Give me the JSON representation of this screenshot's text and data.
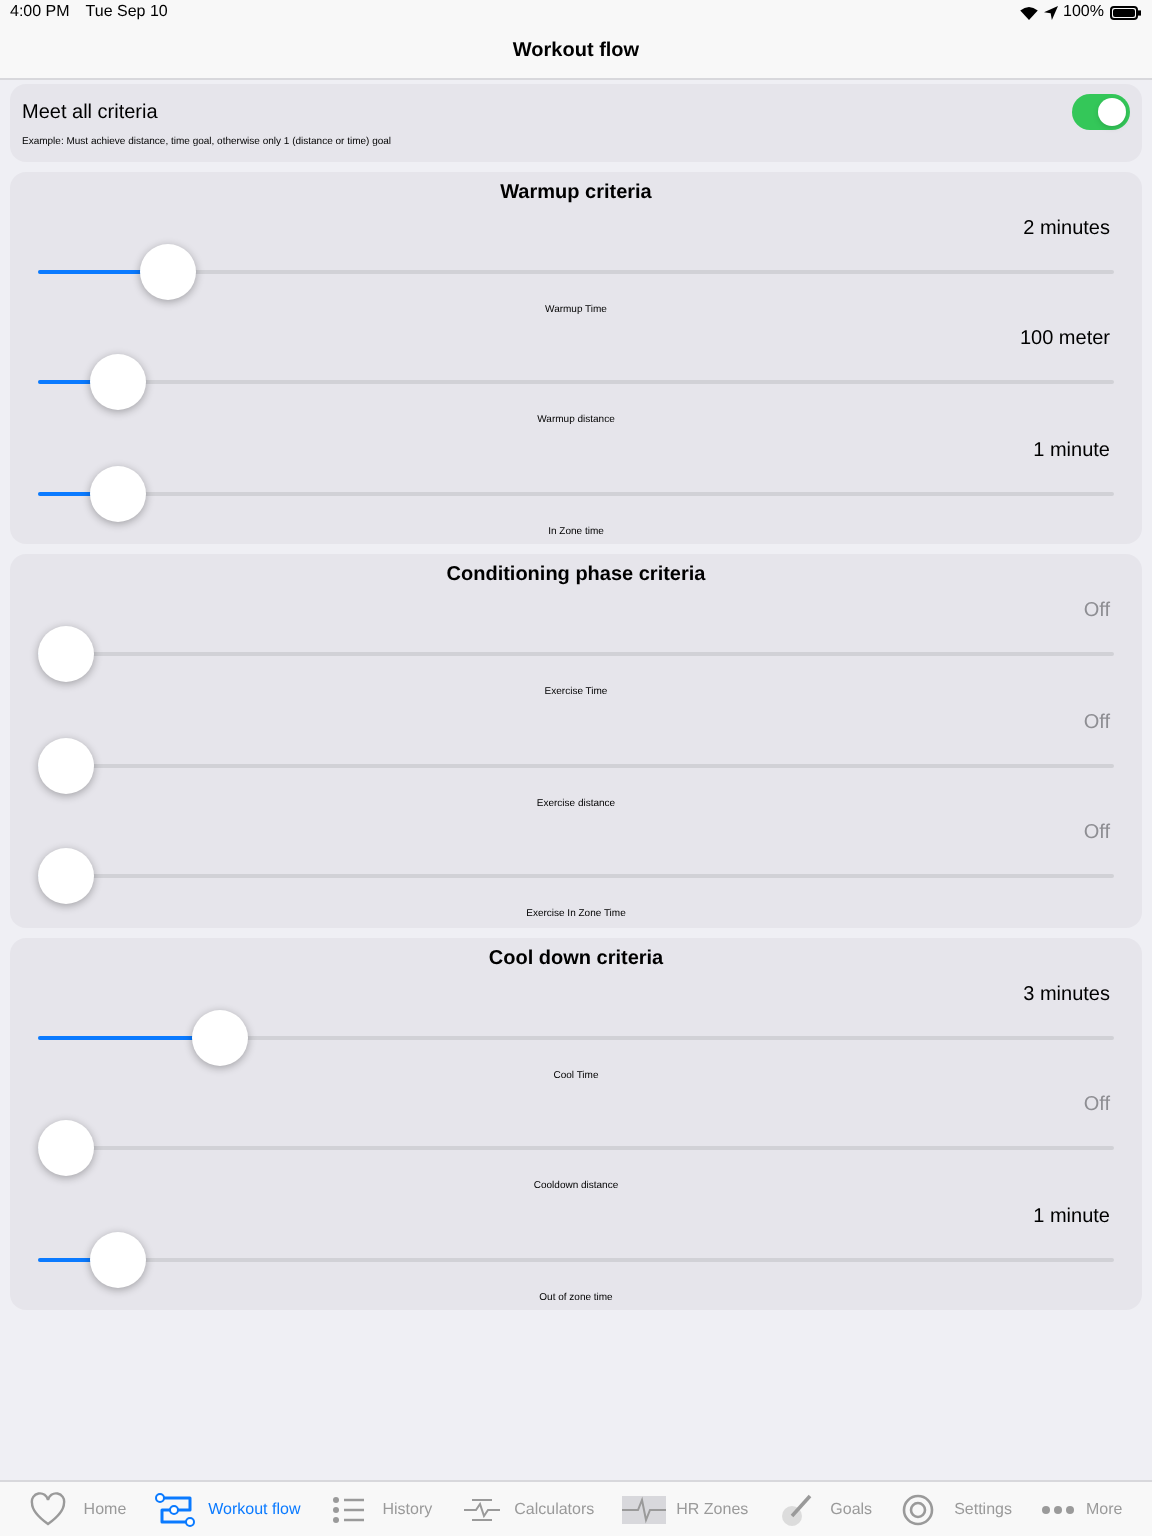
{
  "status_bar": {
    "time": "4:00 PM",
    "date": "Tue Sep 10",
    "battery": "100%"
  },
  "nav_bar": {
    "title": "Workout flow"
  },
  "meet_all": {
    "label": "Meet all criteria",
    "on": true,
    "note": "Example: Must achieve distance, time goal, otherwise only 1 (distance or time) goal"
  },
  "sections": [
    {
      "title": "Warmup criteria",
      "sliders": [
        {
          "reading": "2 minutes",
          "level": 0.1,
          "label": "Warmup Time"
        },
        {
          "reading": "100 meter",
          "level": 0.05,
          "label": "Warmup distance"
        },
        {
          "reading": "1 minute",
          "level": 0.05,
          "label": "In Zone time"
        }
      ]
    },
    {
      "title": "Conditioning phase criteria",
      "sliders": [
        {
          "reading": "Off",
          "level": 0,
          "label": "Exercise Time"
        },
        {
          "reading": "Off",
          "level": 0,
          "label": "Exercise distance"
        },
        {
          "reading": "Off",
          "level": 0,
          "label": "Exercise In Zone Time"
        }
      ]
    },
    {
      "title": "Cool down criteria",
      "sliders": [
        {
          "reading": "3 minutes",
          "level": 0.15,
          "label": "Cool Time"
        },
        {
          "reading": "Off",
          "level": 0,
          "label": "Cooldown distance"
        },
        {
          "reading": "1 minute",
          "level": 0.05,
          "label": "Out of zone time"
        }
      ]
    }
  ],
  "tab_bar": [
    {
      "kind": "heart",
      "label": "Home",
      "selected": false
    },
    {
      "kind": "flow",
      "label": "Workout flow",
      "selected": true
    },
    {
      "kind": "list",
      "label": "History",
      "selected": false
    },
    {
      "kind": "calc",
      "label": "Calculators",
      "selected": false
    },
    {
      "kind": "pulse",
      "label": "HR Zones",
      "selected": false
    },
    {
      "kind": "target",
      "label": "Goals",
      "selected": false
    },
    {
      "kind": "gear",
      "label": "Settings",
      "selected": false
    },
    {
      "kind": "dots",
      "label": "More",
      "selected": false
    }
  ]
}
